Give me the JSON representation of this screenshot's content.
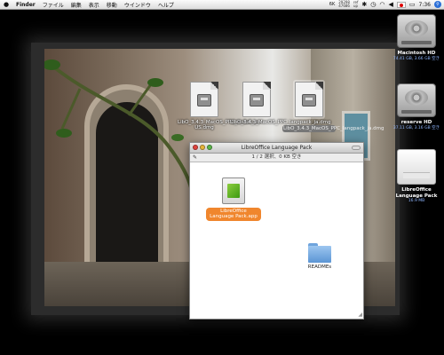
{
  "menubar": {
    "apple": "",
    "items": [
      "Finder",
      "ファイル",
      "編集",
      "表示",
      "移動",
      "ウインドウ",
      "ヘルプ"
    ],
    "status": {
      "rate": "6K",
      "cpu_top": "29298",
      "cpu_bottom": "47686",
      "mem_top": "ref",
      "mem_bottom": "up",
      "clock": "7:36"
    }
  },
  "desktop_files": [
    {
      "label": "LibO_3.4.3_MacOS_PPC_install_en-US.dmg",
      "selected": false
    },
    {
      "label": "LibO_3.4.3_MacOS_PPC_langpack_ja.dmg",
      "selected": false
    },
    {
      "label": "LibO_3.4.3_MacOS_PPC_langpack_ja.dmg",
      "selected": true
    }
  ],
  "finder_window": {
    "title": "LibreOffice Language Pack",
    "status": "1 / 2 選択、0 KB 空き",
    "items": [
      {
        "label": "LibreOffice Language Pack.app",
        "kind": "app",
        "selected": true
      },
      {
        "label": "READMEs",
        "kind": "folder",
        "selected": false
      }
    ]
  },
  "drives": [
    {
      "name": "Macintosh HD",
      "info": "74.41 GB, 3.66 GB 空き",
      "kind": "hd"
    },
    {
      "name": "reserve HD",
      "info": "37.11 GB, 3.16 GB 空き",
      "kind": "hd"
    },
    {
      "name": "LibreOffice Language Pack",
      "info": "16.9 MB",
      "kind": "volume"
    }
  ],
  "colors": {
    "selection_orange": "#f0862d",
    "drive_info_blue": "#8fb6ff",
    "close": "#e0443e",
    "minimize": "#e8b53a",
    "zoom": "#5bb54a"
  }
}
